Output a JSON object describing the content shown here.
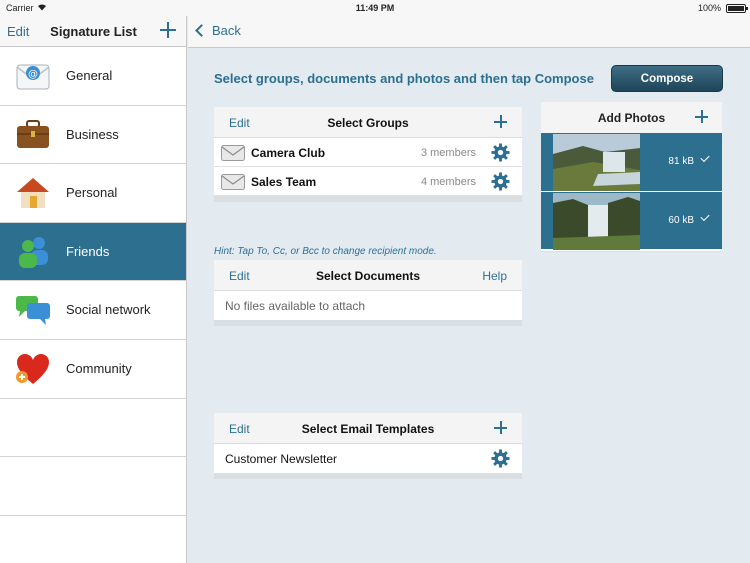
{
  "status_bar": {
    "carrier": "Carrier",
    "time": "11:49 PM",
    "battery": "100%"
  },
  "sidebar": {
    "edit_label": "Edit",
    "title": "Signature List",
    "items": [
      {
        "label": "General",
        "icon": "mail-icon"
      },
      {
        "label": "Business",
        "icon": "briefcase-icon"
      },
      {
        "label": "Personal",
        "icon": "house-icon"
      },
      {
        "label": "Friends",
        "icon": "people-icon",
        "selected": true
      },
      {
        "label": "Social network",
        "icon": "chat-bubbles-icon"
      },
      {
        "label": "Community",
        "icon": "heart-icon"
      }
    ]
  },
  "nav": {
    "back_label": "Back"
  },
  "main": {
    "instruction": "Select groups, documents and photos and then tap Compose",
    "compose_label": "Compose",
    "hint": "Hint: Tap To, Cc, or Bcc to change recipient mode.",
    "groups": {
      "edit_label": "Edit",
      "title": "Select Groups",
      "rows": [
        {
          "name": "Camera Club",
          "count": "3 members"
        },
        {
          "name": "Sales Team",
          "count": "4 members"
        }
      ]
    },
    "documents": {
      "edit_label": "Edit",
      "title": "Select Documents",
      "help_label": "Help",
      "empty_text": "No files available to attach"
    },
    "templates": {
      "edit_label": "Edit",
      "title": "Select Email Templates",
      "rows": [
        {
          "name": "Customer Newsletter"
        }
      ]
    },
    "photos": {
      "title": "Add Photos",
      "items": [
        {
          "size": "81 kB",
          "checked": true
        },
        {
          "size": "60 kB",
          "checked": true
        }
      ]
    }
  },
  "colors": {
    "accent": "#2d6f93",
    "selected_row": "#2d6f8e",
    "background": "#e3ebf1"
  }
}
